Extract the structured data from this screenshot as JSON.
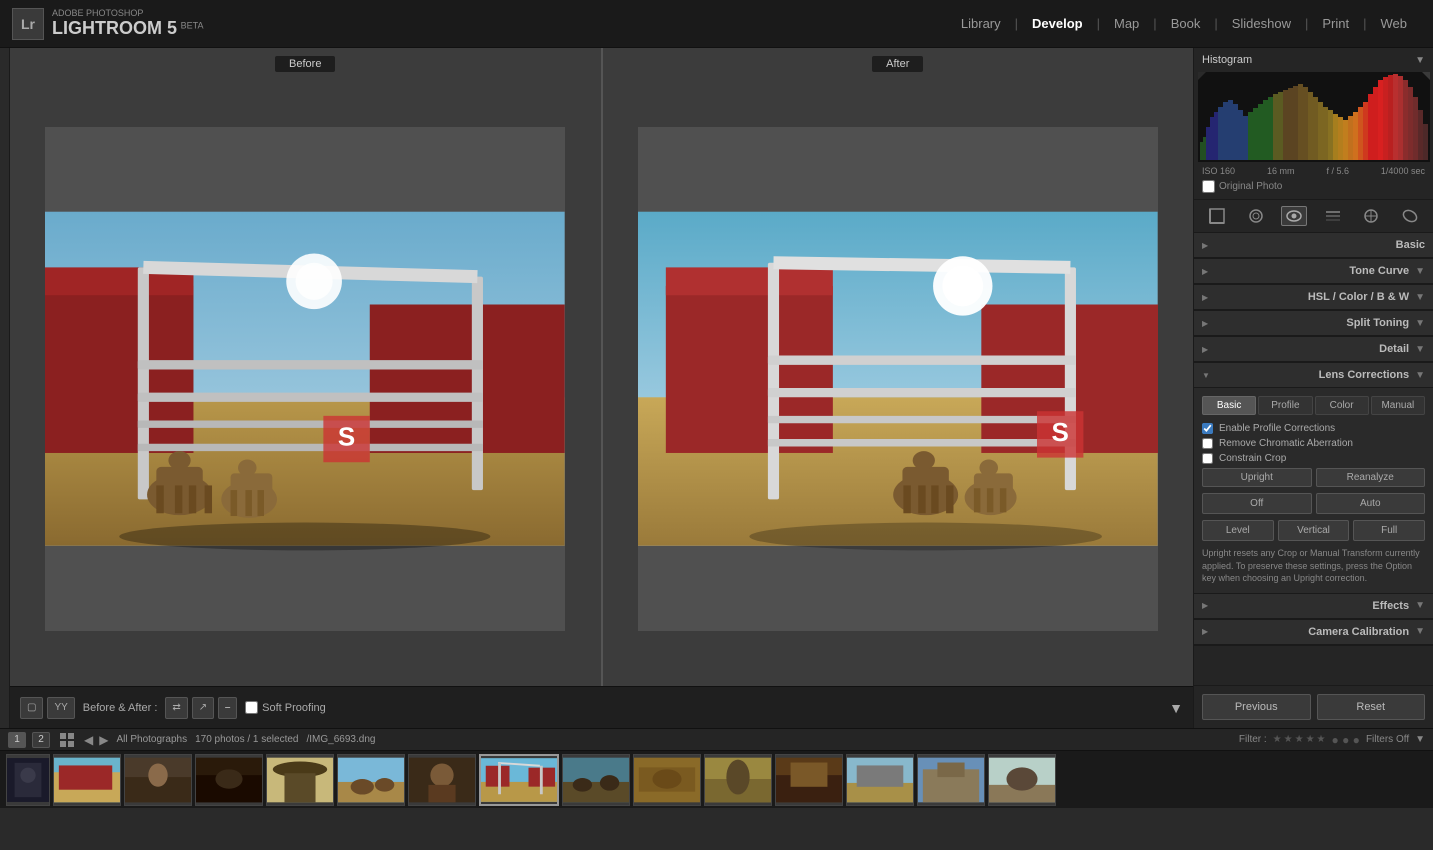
{
  "app": {
    "company": "ADOBE PHOTOSHOP",
    "name": "LIGHTROOM 5",
    "beta": "BETA"
  },
  "nav": {
    "links": [
      "Library",
      "Develop",
      "Map",
      "Book",
      "Slideshow",
      "Print",
      "Web"
    ],
    "active": "Develop"
  },
  "toolbar": {
    "before_label": "Before",
    "after_label": "After",
    "mode_label": "Before & After :",
    "soft_proofing": "Soft Proofing"
  },
  "right_panel": {
    "histogram_title": "Histogram",
    "camera_info": {
      "iso": "ISO 160",
      "focal": "16 mm",
      "aperture": "f / 5.6",
      "shutter": "1/4000 sec"
    },
    "original_photo": "Original Photo",
    "sections": [
      {
        "id": "basic",
        "label": "Basic",
        "expanded": false
      },
      {
        "id": "tone-curve",
        "label": "Tone Curve",
        "expanded": false
      },
      {
        "id": "hsl-color-bw",
        "label": "HSL / Color / B & W",
        "expanded": false
      },
      {
        "id": "split-toning",
        "label": "Split Toning",
        "expanded": false
      },
      {
        "id": "detail",
        "label": "Detail",
        "expanded": false
      },
      {
        "id": "lens-corrections",
        "label": "Lens Corrections",
        "expanded": true
      },
      {
        "id": "effects",
        "label": "Effects",
        "expanded": false
      },
      {
        "id": "camera-calibration",
        "label": "Camera Calibration",
        "expanded": false
      }
    ],
    "lens_corrections": {
      "tabs": [
        "Basic",
        "Profile",
        "Color",
        "Manual"
      ],
      "active_tab": "Basic",
      "checkboxes": [
        {
          "label": "Enable Profile Corrections",
          "checked": true
        },
        {
          "label": "Remove Chromatic Aberration",
          "checked": false
        },
        {
          "label": "Constrain Crop",
          "checked": false
        }
      ],
      "buttons": {
        "upright": "Upright",
        "reanalyze": "Reanalyze",
        "off": "Off",
        "auto": "Auto",
        "level": "Level",
        "vertical": "Vertical",
        "full": "Full"
      },
      "info_text": "Upright resets any Crop or Manual Transform currently applied. To preserve these settings, press the Option key when choosing an Upright correction."
    },
    "previous_label": "Previous",
    "reset_label": "Reset"
  },
  "filmstrip": {
    "pages": [
      "1",
      "2"
    ],
    "source": "All Photographs",
    "count_info": "170 photos / 1 selected",
    "selected_file": "/IMG_6693.dng",
    "filter_label": "Filter :",
    "filters_off": "Filters Off"
  }
}
